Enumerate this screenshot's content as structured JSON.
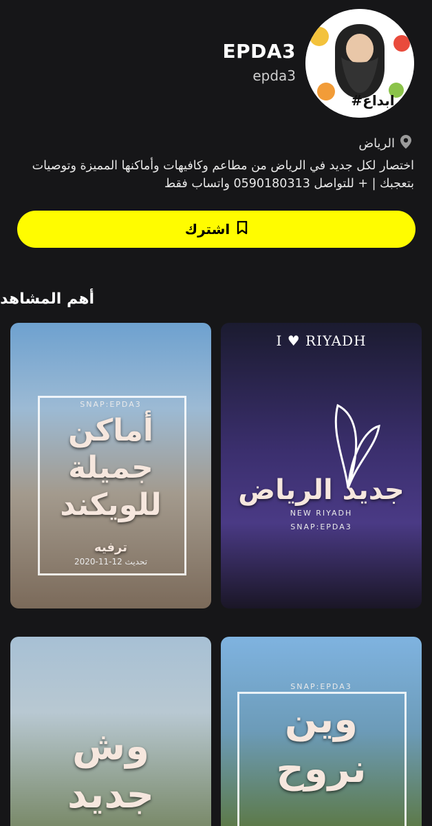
{
  "profile": {
    "name": "EPDA3",
    "handle": "epda3",
    "avatar_text": "#ابداع"
  },
  "location": {
    "city": "الرياض",
    "icon": "location-pin-icon"
  },
  "bio": {
    "line1": "اختصار لكل جديد في الرياض من مطاعم وكافيهات وأماكنها المميزة وتوصيات",
    "line2": "بتعجبك | + للتواصل 0590180313 واتساب فقط"
  },
  "subscribe": {
    "label": "اشترك",
    "icon": "bookmark-icon",
    "color": "#fffc00"
  },
  "highlights": {
    "title": "أهم المشاهد",
    "cards": [
      {
        "title": "جديد الرياض",
        "sign": "I ♥ RIYADH",
        "tag": "SNAP:EPDA3",
        "subtitle": "NEW RIYADH"
      },
      {
        "title_lines": [
          "أماكن",
          "جميلة",
          "للويكند"
        ],
        "tag": "SNAP:EPDA3",
        "category": "ترفيه",
        "date": "تحديث 12-11-2020"
      },
      {
        "title_lines": [
          "وين",
          "نروح"
        ],
        "tag": "SNAP:EPDA3"
      },
      {
        "title_lines": [
          "وش",
          "جديد"
        ]
      }
    ]
  }
}
